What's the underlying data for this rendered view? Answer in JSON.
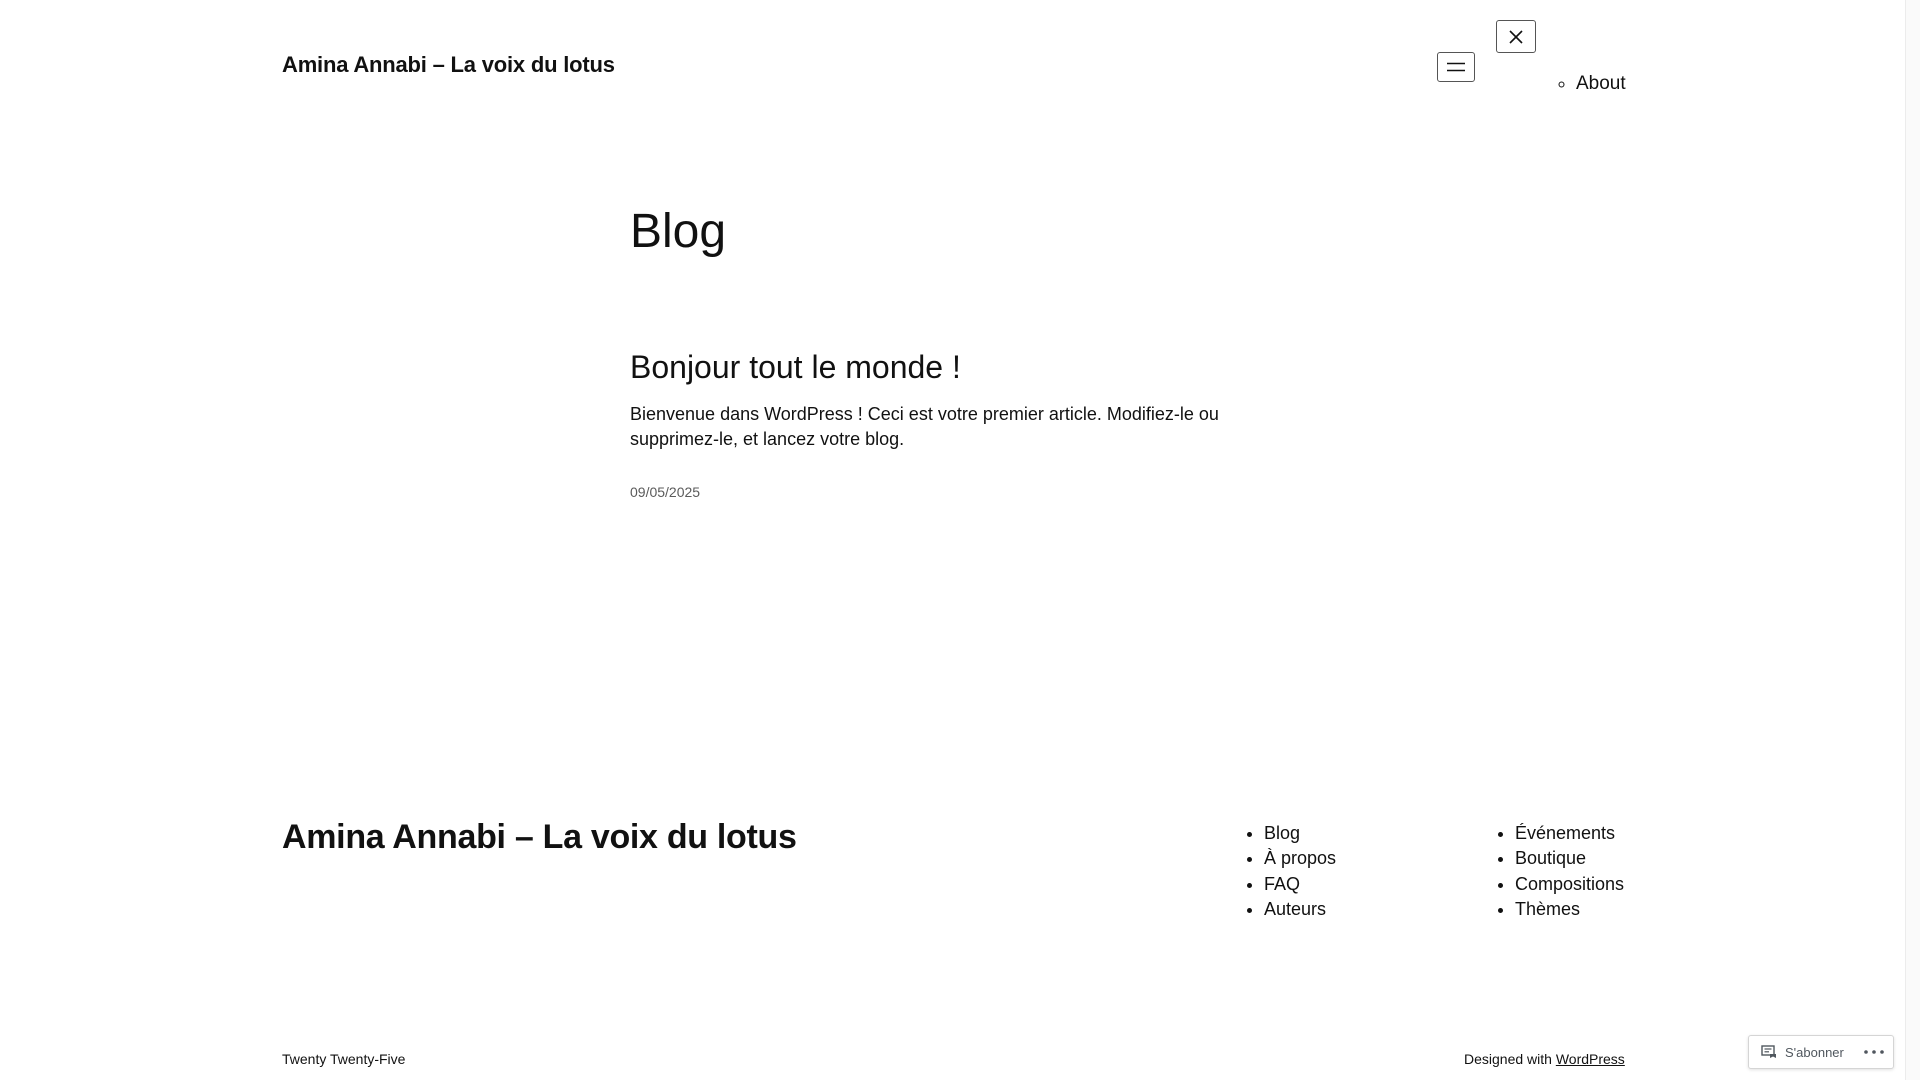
{
  "header": {
    "site_title": "Amina Annabi – La voix du lotus",
    "menu_button_icon": "hamburger-icon",
    "close_button_icon": "close-icon",
    "nav_items": [
      {
        "label": "About"
      }
    ]
  },
  "main": {
    "page_title": "Blog",
    "posts": [
      {
        "title": "Bonjour tout le monde !",
        "excerpt": "Bienvenue dans WordPress ! Ceci est votre premier article. Modifiez-le ou supprimez-le, et lancez votre blog.",
        "date": "09/05/2025"
      }
    ]
  },
  "footer": {
    "site_title": "Amina Annabi – La voix du lotus",
    "nav_col_1": [
      {
        "label": "Blog"
      },
      {
        "label": "À propos"
      },
      {
        "label": "FAQ"
      },
      {
        "label": "Auteurs"
      }
    ],
    "nav_col_2": [
      {
        "label": "Événements"
      },
      {
        "label": "Boutique"
      },
      {
        "label": "Compositions"
      },
      {
        "label": "Thèmes"
      }
    ],
    "theme_credit": "Twenty Twenty-Five",
    "designed_with_prefix": "Designed with ",
    "designed_with_link": "WordPress"
  },
  "subscribe_widget": {
    "label": "S'abonner",
    "icon": "reader-icon",
    "more_icon": "ellipsis-icon"
  },
  "colors": {
    "text": "#111111",
    "muted_date": "#5b5b5b",
    "background": "#ffffff",
    "widget_text": "#50575e"
  }
}
